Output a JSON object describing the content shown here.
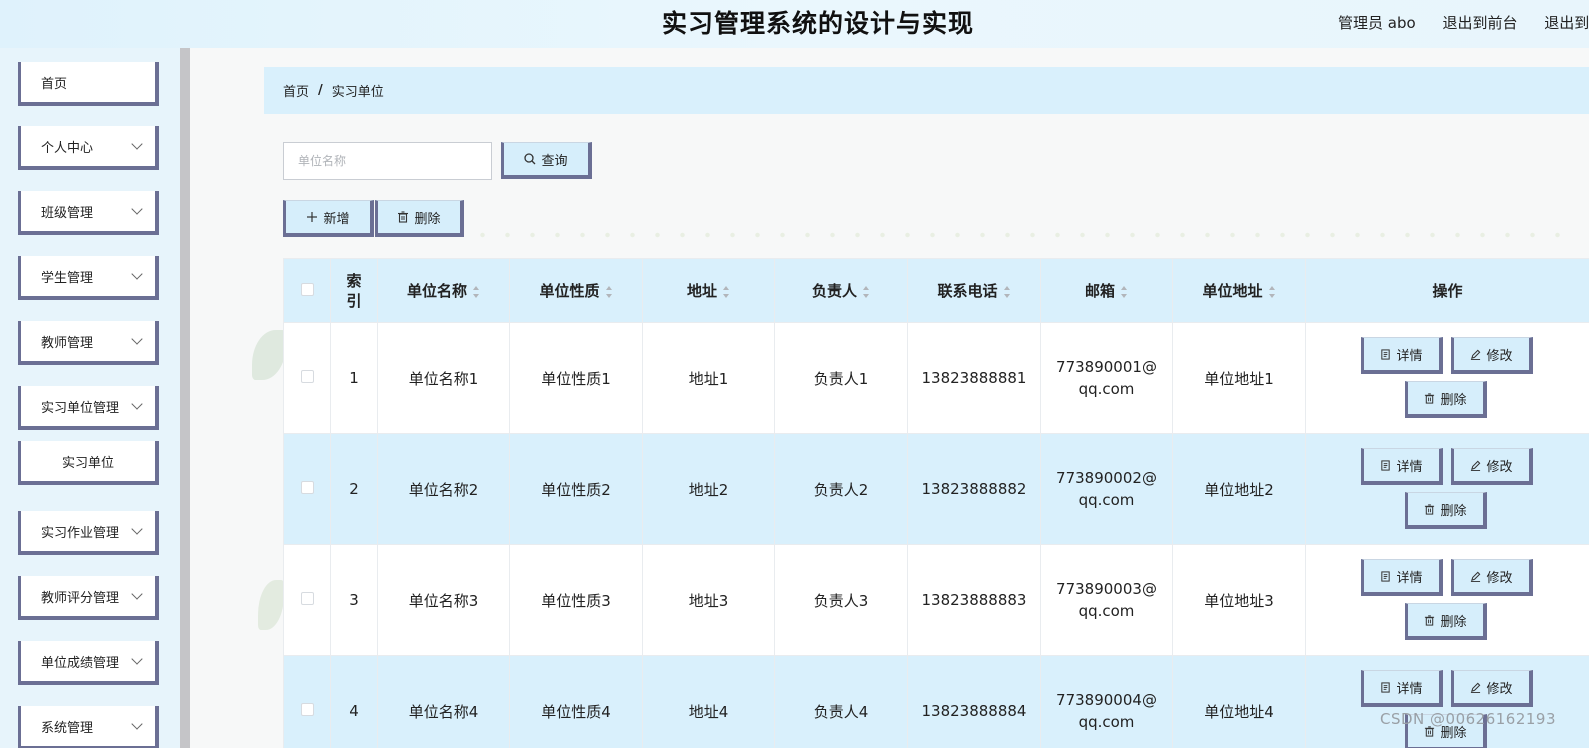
{
  "header": {
    "title": "实习管理系统的设计与实现",
    "admin": "管理员 abo",
    "to_front": "退出到前台",
    "logout": "退出到"
  },
  "sidebar": {
    "items": [
      {
        "label": "首页",
        "has_chevron": false
      },
      {
        "label": "个人中心",
        "has_chevron": true
      },
      {
        "label": "班级管理",
        "has_chevron": true
      },
      {
        "label": "学生管理",
        "has_chevron": true
      },
      {
        "label": "教师管理",
        "has_chevron": true
      },
      {
        "label": "实习单位管理",
        "has_chevron": true
      },
      {
        "label": "实习单位",
        "has_chevron": false,
        "sub": true
      },
      {
        "label": "实习作业管理",
        "has_chevron": true
      },
      {
        "label": "教师评分管理",
        "has_chevron": true
      },
      {
        "label": "单位成绩管理",
        "has_chevron": true
      },
      {
        "label": "系统管理",
        "has_chevron": true
      }
    ]
  },
  "breadcrumb": {
    "home": "首页",
    "sep": "/",
    "current": "实习单位"
  },
  "search": {
    "placeholder": "单位名称",
    "button": "查询"
  },
  "toolbar": {
    "add": "新增",
    "delete": "删除"
  },
  "table": {
    "headers": {
      "index": "索引",
      "name": "单位名称",
      "nature": "单位性质",
      "address": "地址",
      "person": "负责人",
      "phone": "联系电话",
      "email": "邮箱",
      "unit_address": "单位地址",
      "ops": "操作"
    },
    "rows": [
      {
        "index": "1",
        "name": "单位名称1",
        "nature": "单位性质1",
        "address": "地址1",
        "person": "负责人1",
        "phone": "13823888881",
        "email": "773890001@qq.com",
        "unit_address": "单位地址1"
      },
      {
        "index": "2",
        "name": "单位名称2",
        "nature": "单位性质2",
        "address": "地址2",
        "person": "负责人2",
        "phone": "13823888882",
        "email": "773890002@qq.com",
        "unit_address": "单位地址2"
      },
      {
        "index": "3",
        "name": "单位名称3",
        "nature": "单位性质3",
        "address": "地址3",
        "person": "负责人3",
        "phone": "13823888883",
        "email": "773890003@qq.com",
        "unit_address": "单位地址3"
      },
      {
        "index": "4",
        "name": "单位名称4",
        "nature": "单位性质4",
        "address": "地址4",
        "person": "负责人4",
        "phone": "13823888884",
        "email": "773890004@qq.com",
        "unit_address": "单位地址4"
      }
    ],
    "row_actions": {
      "detail": "详情",
      "edit": "修改",
      "delete": "删除"
    }
  },
  "watermark": "CSDN @00626162193",
  "colors": {
    "accent": "#6b6f94",
    "light_blue": "#d9f0fc"
  }
}
